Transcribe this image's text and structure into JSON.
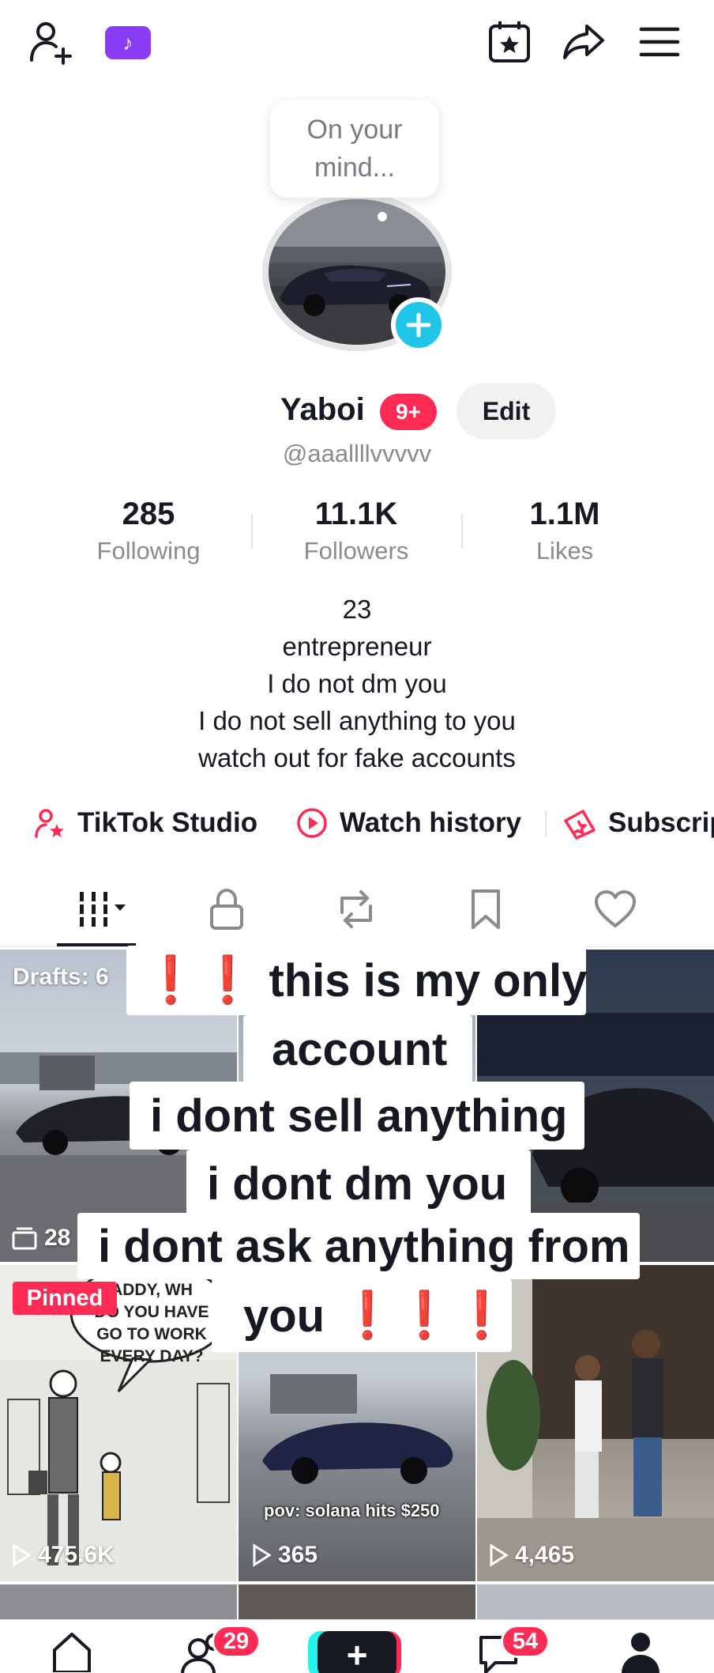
{
  "top_bar": {
    "icons": [
      "add-friend-icon",
      "tiktok-badge-icon",
      "calendar-star-icon",
      "share-icon",
      "menu-icon"
    ],
    "tiktok_badge_glyph": "♪"
  },
  "profile": {
    "note_bubble": "On your mind...",
    "display_name": "Yaboi",
    "notification_badge": "9+",
    "edit_label": "Edit",
    "handle": "@aaallllvvvvv"
  },
  "stats": [
    {
      "value": "285",
      "label": "Following"
    },
    {
      "value": "11.1K",
      "label": "Followers"
    },
    {
      "value": "1.1M",
      "label": "Likes"
    }
  ],
  "bio": {
    "lines": [
      "23",
      "entrepreneur",
      "I do not dm you",
      "I do not sell anything to you",
      "watch out for fake accounts"
    ]
  },
  "quick_links": [
    {
      "label": "TikTok Studio",
      "icon": "studio-user-icon"
    },
    {
      "label": "Watch history",
      "icon": "play-circle-icon"
    },
    {
      "label": "Subscrip",
      "icon": "subscription-icon"
    }
  ],
  "tabs": [
    "videos-grid-icon",
    "lock-icon",
    "repost-icon",
    "bookmark-icon",
    "heart-icon"
  ],
  "grid": {
    "drafts_label": "Drafts: 6",
    "drafts_count": "28",
    "pinned_label": "Pinned",
    "comic_text": "DADDY, WHY DO YOU HAVE TO GO TO WORK EVERY DAY?",
    "comic_visible_text": "ADDY, WH\nDO YOU HAVE\nGO TO WORK\nEVERY DAY?",
    "video_caption": "pov: solana hits $250",
    "views": [
      "475.6K",
      "365",
      "4,465"
    ]
  },
  "overlay_text": {
    "line1": "this is my only",
    "line2": "account",
    "line3": "i dont sell anything",
    "line4": "i dont dm you",
    "line5": "i dont ask anything from",
    "line6": "you",
    "bang_double": "❗❗",
    "bang_triple": "❗❗❗"
  },
  "bottom_nav": {
    "friends_badge": "29",
    "inbox_badge": "54",
    "plus_label": "+"
  },
  "colors": {
    "brand_red": "#fe2c55",
    "accent_cyan": "#20c5e8",
    "tiktok_purple": "#8b3cf6",
    "text_primary": "#161823",
    "text_secondary": "#8a8b91"
  }
}
